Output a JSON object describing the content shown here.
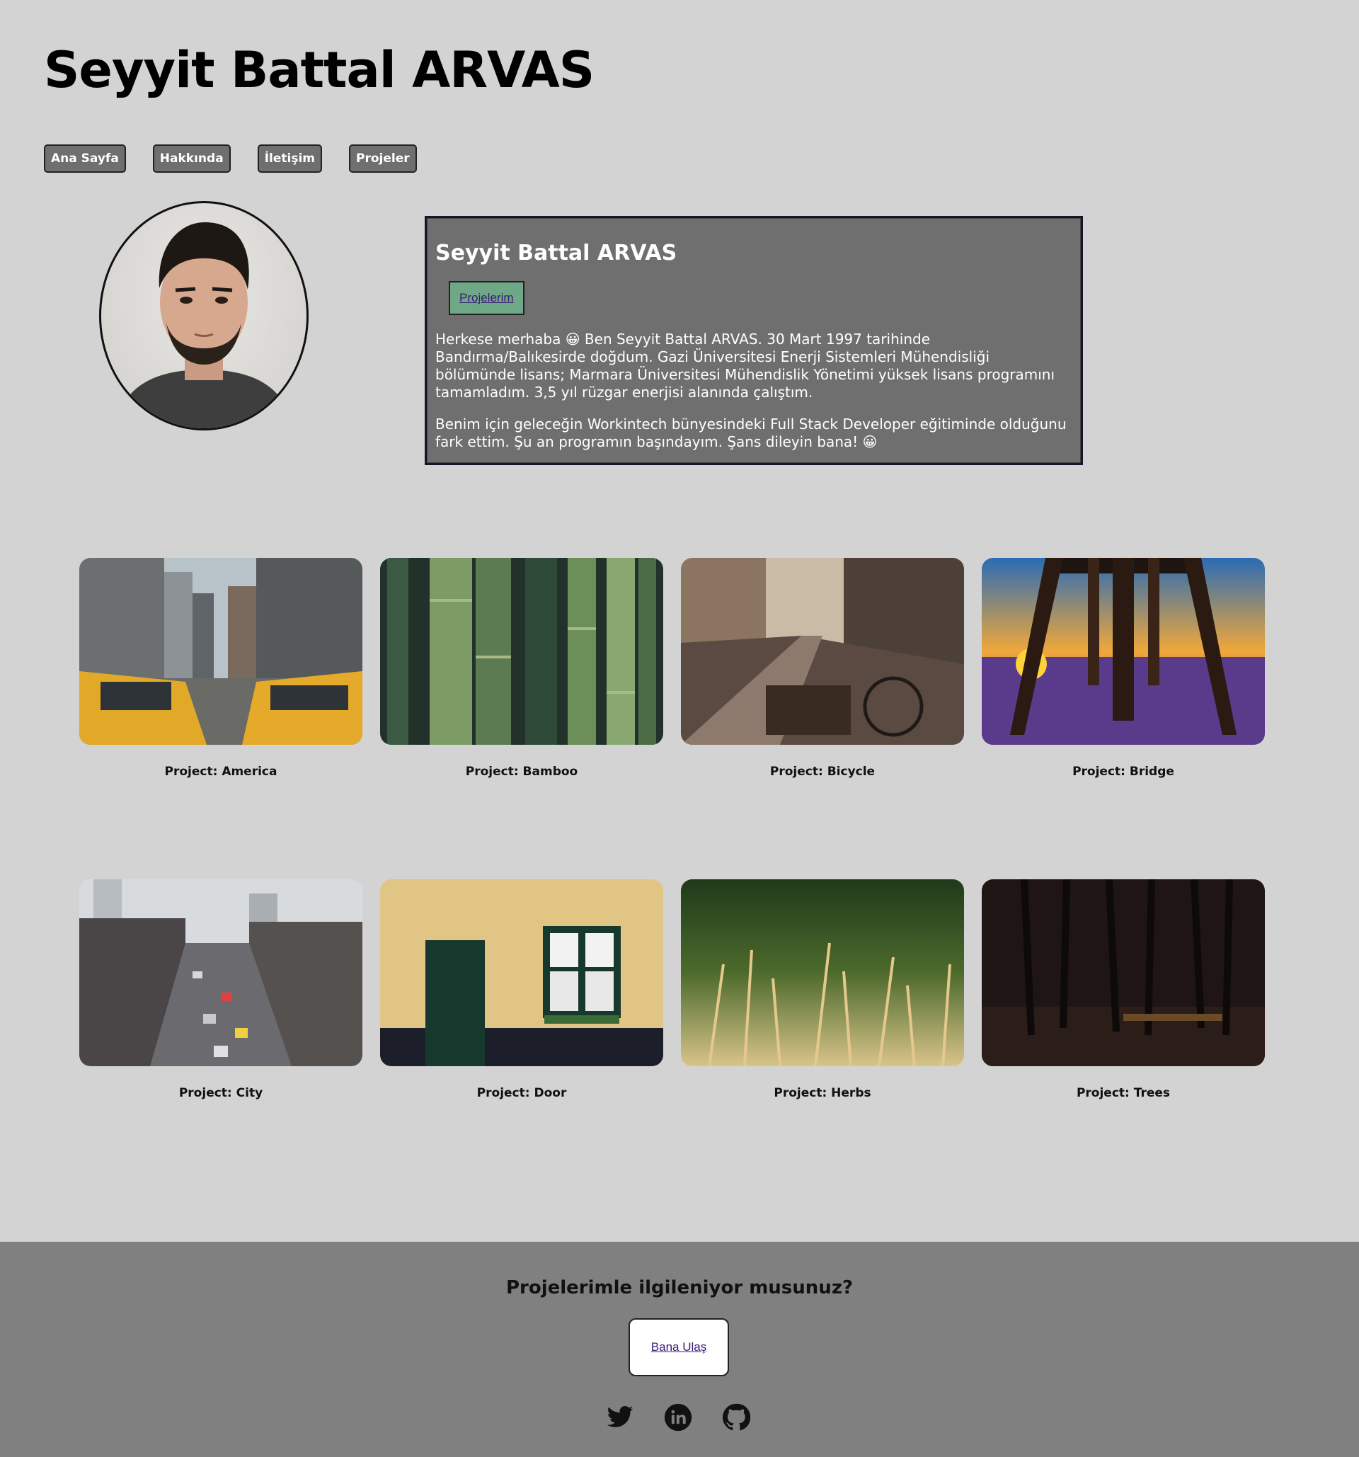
{
  "header": {
    "title": "Seyyit Battal ARVAS"
  },
  "nav": {
    "items": [
      "Ana Sayfa",
      "Hakkında",
      "İletişim",
      "Projeler"
    ]
  },
  "bio": {
    "name": "Seyyit Battal ARVAS",
    "button": "Projelerim",
    "paragraph1": "Herkese merhaba 😀 Ben Seyyit Battal ARVAS. 30 Mart 1997 tarihinde Bandırma/Balıkesirde doğdum. Gazi Üniversitesi Enerji Sistemleri Mühendisliği bölümünde lisans; Marmara Üniversitesi Mühendislik Yönetimi yüksek lisans programını tamamladım. 3,5 yıl rüzgar enerjisi alanında çalıştım.",
    "paragraph2": "Benim için geleceğin Workintech bünyesindeki Full Stack Developer eğitiminde olduğunu fark ettim. Şu an programın başındayım. Şans dileyin bana! 😀"
  },
  "projects": [
    {
      "caption": "Project: America"
    },
    {
      "caption": "Project: Bamboo"
    },
    {
      "caption": "Project: Bicycle"
    },
    {
      "caption": "Project: Bridge"
    },
    {
      "caption": "Project: City"
    },
    {
      "caption": "Project: Door"
    },
    {
      "caption": "Project: Herbs"
    },
    {
      "caption": "Project: Trees"
    }
  ],
  "footer": {
    "question": "Projelerimle ilgileniyor musunuz?",
    "button": "Bana Ulaş",
    "social": [
      "twitter-icon",
      "linkedin-icon",
      "github-icon"
    ]
  },
  "colors": {
    "background": "#d3d3d3",
    "panel": "#6f6f6f",
    "accent_button": "#6fa886",
    "footer": "#808080",
    "link": "#3a1a7a"
  }
}
